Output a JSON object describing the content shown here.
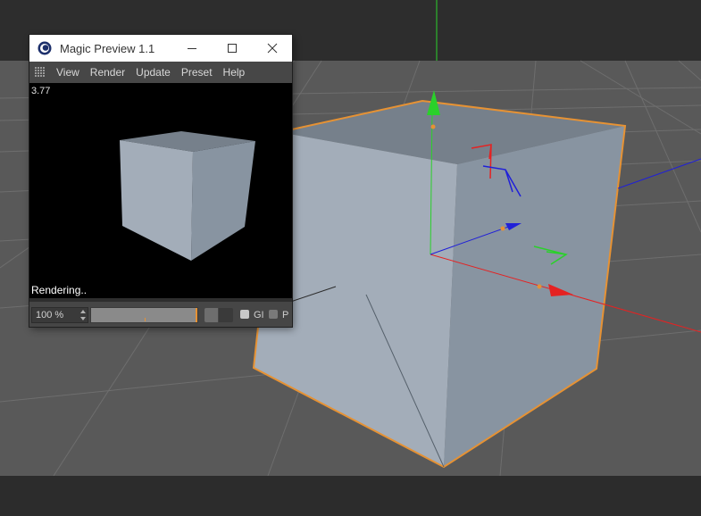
{
  "preview": {
    "title": "Magic Preview 1.1",
    "menu": [
      "View",
      "Render",
      "Update",
      "Preset",
      "Help"
    ],
    "fps": "3.77",
    "status": "Rendering..",
    "zoom": "100 %",
    "progress": 1.0,
    "options": {
      "gi_label": "GI",
      "p_label": "P"
    }
  },
  "colors": {
    "viewport_bg": "#595959",
    "grid": "#6a6a6a",
    "cube_front": "#a3adb9",
    "cube_side": "#8894a1",
    "cube_top": "#76808b",
    "selection": "#e69234",
    "axis_x": "#e52222",
    "axis_y": "#2ad12a",
    "axis_z": "#2020d8"
  },
  "icons": {
    "app": "cinema4d-logo-icon",
    "grip": "menu-grip-icon",
    "minimize": "minimize-icon",
    "maximize": "maximize-icon",
    "close": "close-icon"
  }
}
